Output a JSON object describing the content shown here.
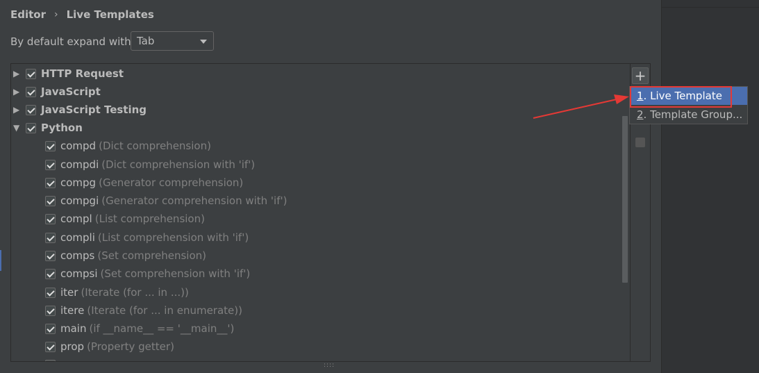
{
  "breadcrumb": {
    "parent": "Editor",
    "current": "Live Templates"
  },
  "expand": {
    "label": "By default expand with",
    "selected": "Tab"
  },
  "tree": {
    "groups": [
      {
        "name": "HTTP Request",
        "checked": true,
        "expanded": false
      },
      {
        "name": "JavaScript",
        "checked": true,
        "expanded": false
      },
      {
        "name": "JavaScript Testing",
        "checked": true,
        "expanded": false
      },
      {
        "name": "Python",
        "checked": true,
        "expanded": true
      }
    ],
    "templates": [
      {
        "abbr": "compd",
        "desc": "(Dict comprehension)"
      },
      {
        "abbr": "compdi",
        "desc": "(Dict comprehension with 'if')"
      },
      {
        "abbr": "compg",
        "desc": "(Generator comprehension)"
      },
      {
        "abbr": "compgi",
        "desc": "(Generator comprehension with 'if')"
      },
      {
        "abbr": "compl",
        "desc": "(List comprehension)"
      },
      {
        "abbr": "compli",
        "desc": "(List comprehension with 'if')"
      },
      {
        "abbr": "comps",
        "desc": "(Set comprehension)"
      },
      {
        "abbr": "compsi",
        "desc": "(Set comprehension with 'if')"
      },
      {
        "abbr": "iter",
        "desc": "(Iterate (for ... in ...))"
      },
      {
        "abbr": "itere",
        "desc": "(Iterate (for ... in enumerate))"
      },
      {
        "abbr": "main",
        "desc": "(if __name__ == '__main__')"
      },
      {
        "abbr": "prop",
        "desc": "(Property getter)"
      }
    ]
  },
  "toolbar": {
    "add_symbol": "+"
  },
  "popup": {
    "items": [
      {
        "mnemonic": "1",
        "label": ". Live Template",
        "selected": true
      },
      {
        "mnemonic": "2",
        "label": ". Template Group..."
      }
    ]
  },
  "colors": {
    "background": "#3c3f41",
    "selection": "#4b6eaf",
    "annotation": "#e53935"
  }
}
